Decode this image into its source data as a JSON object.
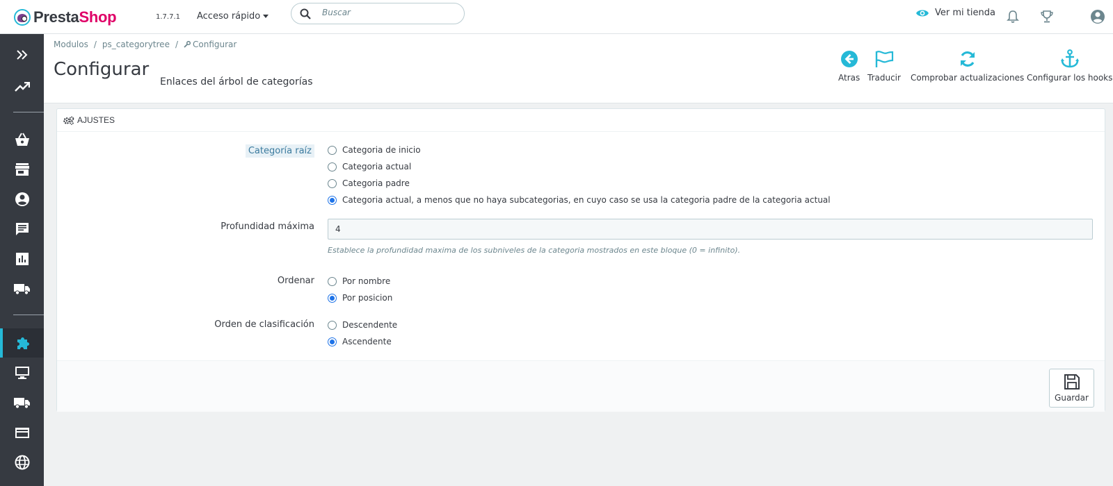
{
  "header": {
    "brand_part1": "Presta",
    "brand_part2": "Shop",
    "version": "1.7.7.1",
    "quick_access": "Acceso rápido",
    "search_placeholder": "Buscar",
    "view_store": "Ver mi tienda"
  },
  "breadcrumb": {
    "items": [
      "Modulos",
      "ps_categorytree",
      "Configurar"
    ]
  },
  "page": {
    "title": "Configurar",
    "subtitle": "Enlaces del árbol de categorías"
  },
  "toolbar": {
    "back": "Atras",
    "translate": "Traducir",
    "check_updates": "Comprobar actualizaciones",
    "hooks": "Configurar los hooks"
  },
  "panel": {
    "heading": "AJUSTES",
    "root_category": {
      "label": "Categoría raíz",
      "options": [
        {
          "label": "Categoria de inicio",
          "checked": false
        },
        {
          "label": "Categoria actual",
          "checked": false
        },
        {
          "label": "Categoria padre",
          "checked": false
        },
        {
          "label": "Categoria actual, a menos que no haya subcategorias, en cuyo caso se usa la categoria padre de la categoria actual",
          "checked": true
        }
      ]
    },
    "max_depth": {
      "label": "Profundidad máxima",
      "value": "4",
      "help": "Establece la profundidad maxima de los subniveles de la categoria mostrados en este bloque (0 = infinito)."
    },
    "sort": {
      "label": "Ordenar",
      "options": [
        {
          "label": "Por nombre",
          "checked": false
        },
        {
          "label": "Por posicion",
          "checked": true
        }
      ]
    },
    "sort_order": {
      "label": "Orden de clasificación",
      "options": [
        {
          "label": "Descendente",
          "checked": false
        },
        {
          "label": "Ascendente",
          "checked": true
        }
      ]
    },
    "save": "Guardar"
  },
  "colors": {
    "accent": "#25b9d7",
    "sidebar": "#363a41",
    "brand_pink": "#df0067"
  }
}
